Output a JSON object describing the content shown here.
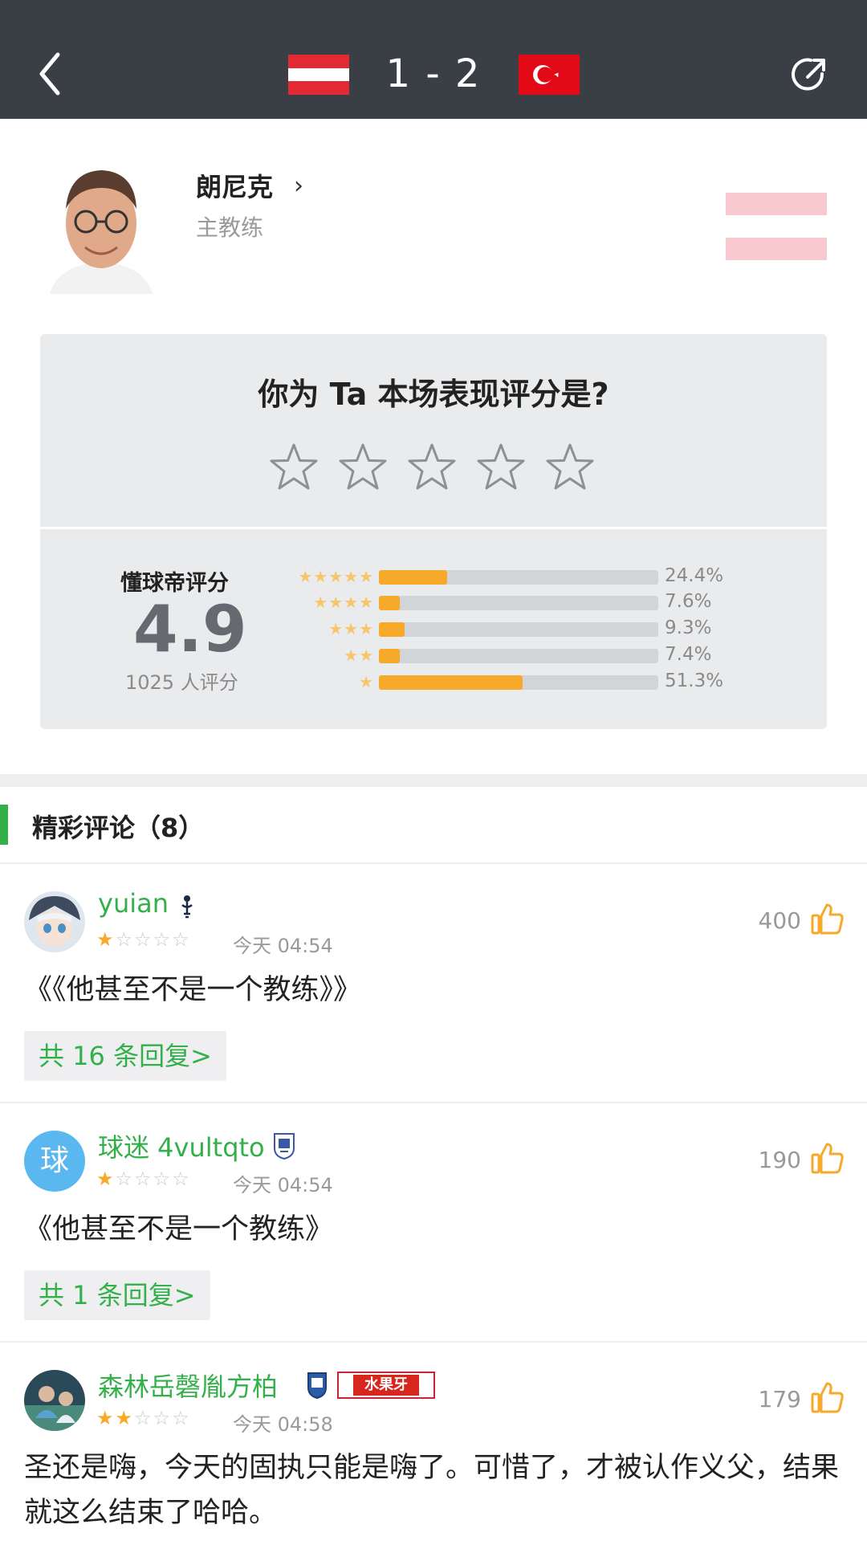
{
  "header": {
    "score": "1 - 2",
    "back_icon": "chevron-left-icon",
    "share_icon": "share-icon",
    "home_flag": "austria-flag",
    "away_flag": "turkey-flag"
  },
  "coach": {
    "name": "朗尼克",
    "role": "主教练",
    "chevron": "›"
  },
  "rating": {
    "question": "你为 Ta 本场表现评分是?",
    "label": "懂球帝评分",
    "score": "4.9",
    "count": "1025 人评分",
    "distribution": [
      {
        "stars": "★★★★★",
        "percent": "24.4%",
        "value": 24.4
      },
      {
        "stars": "★★★★",
        "percent": "7.6%",
        "value": 7.6
      },
      {
        "stars": "★★★",
        "percent": "9.3%",
        "value": 9.3
      },
      {
        "stars": "★★",
        "percent": "7.4%",
        "value": 7.4
      },
      {
        "stars": "★",
        "percent": "51.3%",
        "value": 51.3
      }
    ]
  },
  "comments_section": {
    "title": "精彩评论（8）"
  },
  "comments": [
    {
      "user": "yuian",
      "rating": 1,
      "time": "今天 04:54",
      "likes": "400",
      "text": "《《他甚至不是一个教练》》",
      "replies": "共 16 条回复>"
    },
    {
      "user": "球迷 4vultqto",
      "avatar_char": "球",
      "rating": 1,
      "time": "今天 04:54",
      "likes": "190",
      "text": "《他甚至不是一个教练》",
      "replies": "共 1 条回复>"
    },
    {
      "user": "森林岳磬胤方柏",
      "badge_text": "水果牙",
      "rating": 2,
      "time": "今天 04:58",
      "likes": "179",
      "text": "圣还是嗨，今天的固执只能是嗨了。可惜了，才被认作义父，结果就这么结束了哈哈。"
    }
  ],
  "colors": {
    "header_bg": "#3a3f46",
    "accent_green": "#34b04a",
    "bar_orange": "#f7a92a"
  }
}
